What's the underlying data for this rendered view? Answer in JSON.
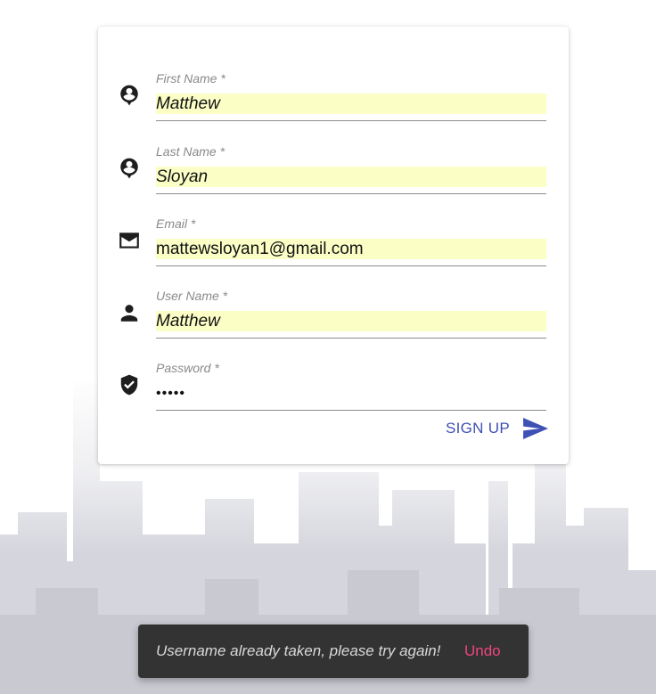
{
  "form": {
    "fields": [
      {
        "label": "First Name *",
        "value": "Matthew",
        "icon": "account-circle-icon"
      },
      {
        "label": "Last Name *",
        "value": "Sloyan",
        "icon": "account-circle-icon"
      },
      {
        "label": "Email *",
        "value": "mattewsloyan1@gmail.com",
        "icon": "email-icon"
      },
      {
        "label": "User Name *",
        "value": "Matthew",
        "icon": "person-icon"
      },
      {
        "label": "Password *",
        "value": "•••••",
        "icon": "verified-shield-icon"
      }
    ],
    "submit_label": "SIGN UP",
    "submit_icon": "send-icon"
  },
  "snackbar": {
    "message": "Username already taken, please try again!",
    "action_label": "Undo"
  },
  "colors": {
    "accent": "#3f51b5",
    "autofill": "#fbffc6",
    "snackbar_bg": "#333333",
    "snackbar_action": "#f0457f"
  }
}
